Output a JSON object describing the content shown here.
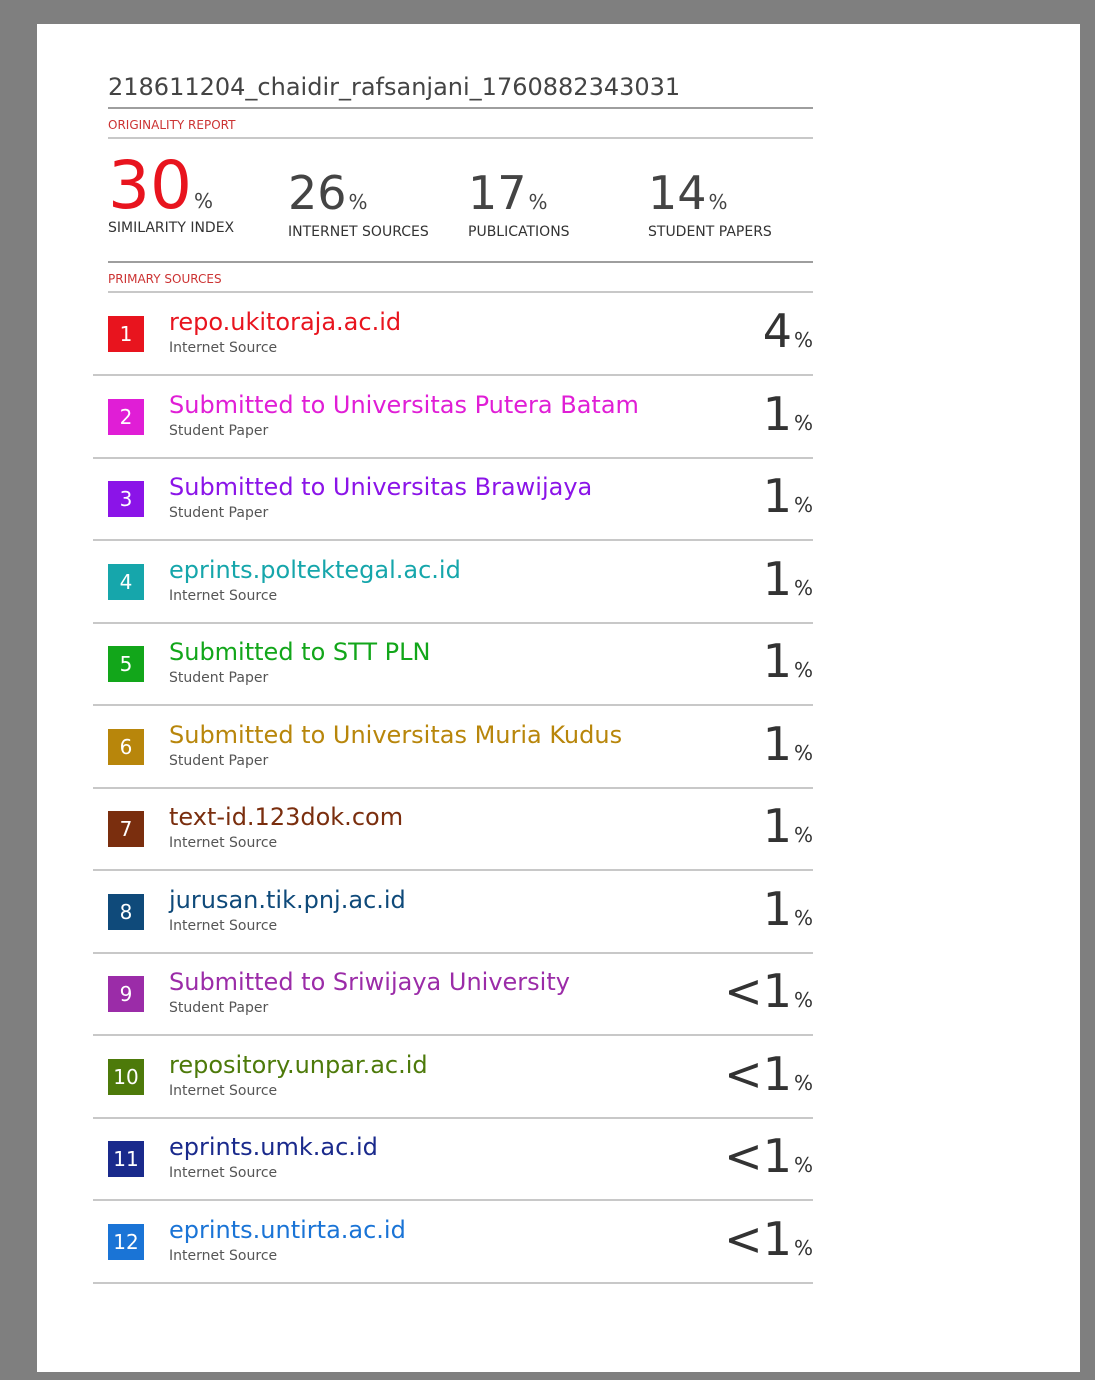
{
  "document": {
    "title": "218611204_chaidir_rafsanjani_1760882343031"
  },
  "report": {
    "section_label": "ORIGINALITY REPORT",
    "stats": [
      {
        "value": "30",
        "unit": "%",
        "label": "SIMILARITY INDEX"
      },
      {
        "value": "26",
        "unit": "%",
        "label": "INTERNET SOURCES"
      },
      {
        "value": "17",
        "unit": "%",
        "label": "PUBLICATIONS"
      },
      {
        "value": "14",
        "unit": "%",
        "label": "STUDENT PAPERS"
      }
    ]
  },
  "sources": {
    "section_label": "PRIMARY SOURCES",
    "items": [
      {
        "rank": "1",
        "name": "repo.ukitoraja.ac.id",
        "type": "Internet Source",
        "value": "4",
        "unit": "%",
        "color": "#e8141e"
      },
      {
        "rank": "2",
        "name": "Submitted to Universitas Putera Batam",
        "type": "Student Paper",
        "value": "1",
        "unit": "%",
        "color": "#e01ed6"
      },
      {
        "rank": "3",
        "name": "Submitted to Universitas Brawijaya",
        "type": "Student Paper",
        "value": "1",
        "unit": "%",
        "color": "#8b14e8"
      },
      {
        "rank": "4",
        "name": "eprints.poltektegal.ac.id",
        "type": "Internet Source",
        "value": "1",
        "unit": "%",
        "color": "#16a6ab"
      },
      {
        "rank": "5",
        "name": "Submitted to STT PLN",
        "type": "Student Paper",
        "value": "1",
        "unit": "%",
        "color": "#12a61a"
      },
      {
        "rank": "6",
        "name": "Submitted to Universitas Muria Kudus",
        "type": "Student Paper",
        "value": "1",
        "unit": "%",
        "color": "#b8860b"
      },
      {
        "rank": "7",
        "name": "text-id.123dok.com",
        "type": "Internet Source",
        "value": "1",
        "unit": "%",
        "color": "#7a2e0e"
      },
      {
        "rank": "8",
        "name": "jurusan.tik.pnj.ac.id",
        "type": "Internet Source",
        "value": "1",
        "unit": "%",
        "color": "#0f4a7a"
      },
      {
        "rank": "9",
        "name": "Submitted to Sriwijaya University",
        "type": "Student Paper",
        "value": "<1",
        "unit": "%",
        "color": "#9b2ca8"
      },
      {
        "rank": "10",
        "name": "repository.unpar.ac.id",
        "type": "Internet Source",
        "value": "<1",
        "unit": "%",
        "color": "#4d7a0a"
      },
      {
        "rank": "11",
        "name": "eprints.umk.ac.id",
        "type": "Internet Source",
        "value": "<1",
        "unit": "%",
        "color": "#1a2a8c"
      },
      {
        "rank": "12",
        "name": "eprints.untirta.ac.id",
        "type": "Internet Source",
        "value": "<1",
        "unit": "%",
        "color": "#1a74d6"
      }
    ]
  }
}
